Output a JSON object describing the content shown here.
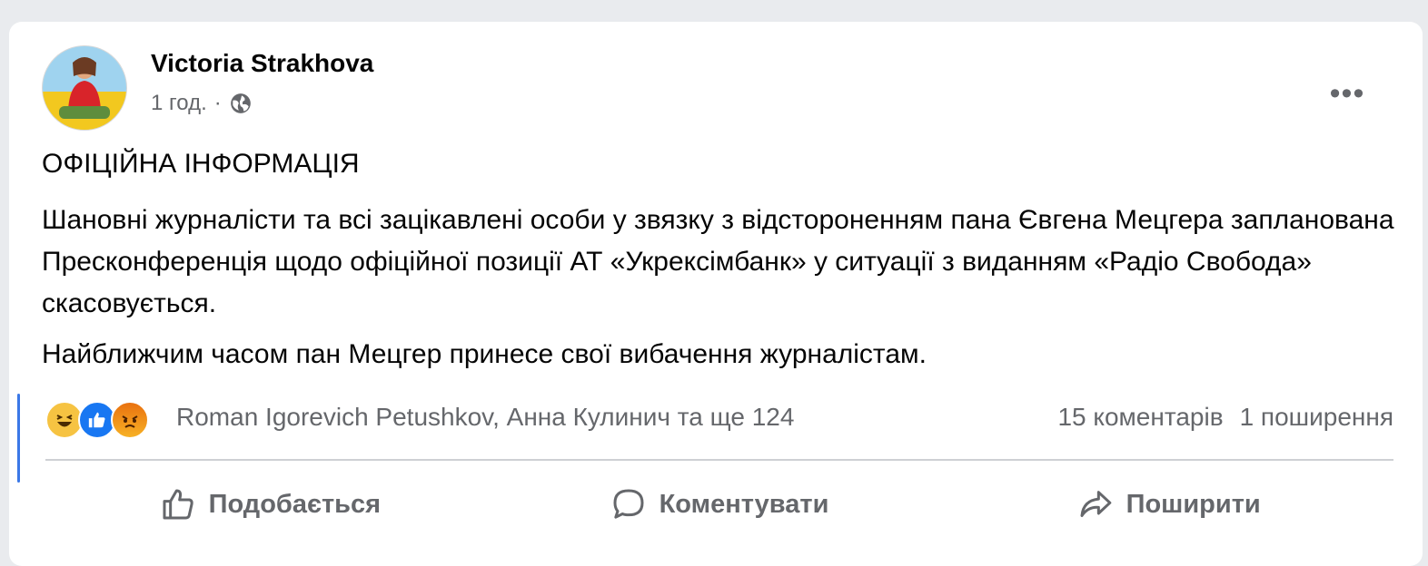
{
  "post": {
    "author": "Victoria Strakhova",
    "time": "1 год.",
    "time_separator": "·",
    "title": "ОФІЦІЙНА ІНФОРМАЦІЯ",
    "paragraphs": [
      "Шановні журналісти та всі зацікавлені особи у звязку з відстороненням пана Євгена Мецгера запланована Пресконференція щодо офіційної позиції АТ «Укрексімбанк» у ситуації з виданням «Радіо Свобода» скасовується.",
      "Найближчим часом пан Мецгер принесе свої вибачення журналістам."
    ]
  },
  "reactions": {
    "types": [
      "haha",
      "like",
      "angry"
    ],
    "reactors_text": "Roman Igorevich Petushkov, Анна Кулинич та ще 124",
    "comments": "15 коментарів",
    "shares": "1 поширення"
  },
  "actions": {
    "like": "Подобається",
    "comment": "Коментувати",
    "share": "Поширити"
  },
  "colors": {
    "background": "#e9ebee",
    "card": "#ffffff",
    "secondary_text": "#65676b",
    "like_blue": "#1877f2"
  }
}
